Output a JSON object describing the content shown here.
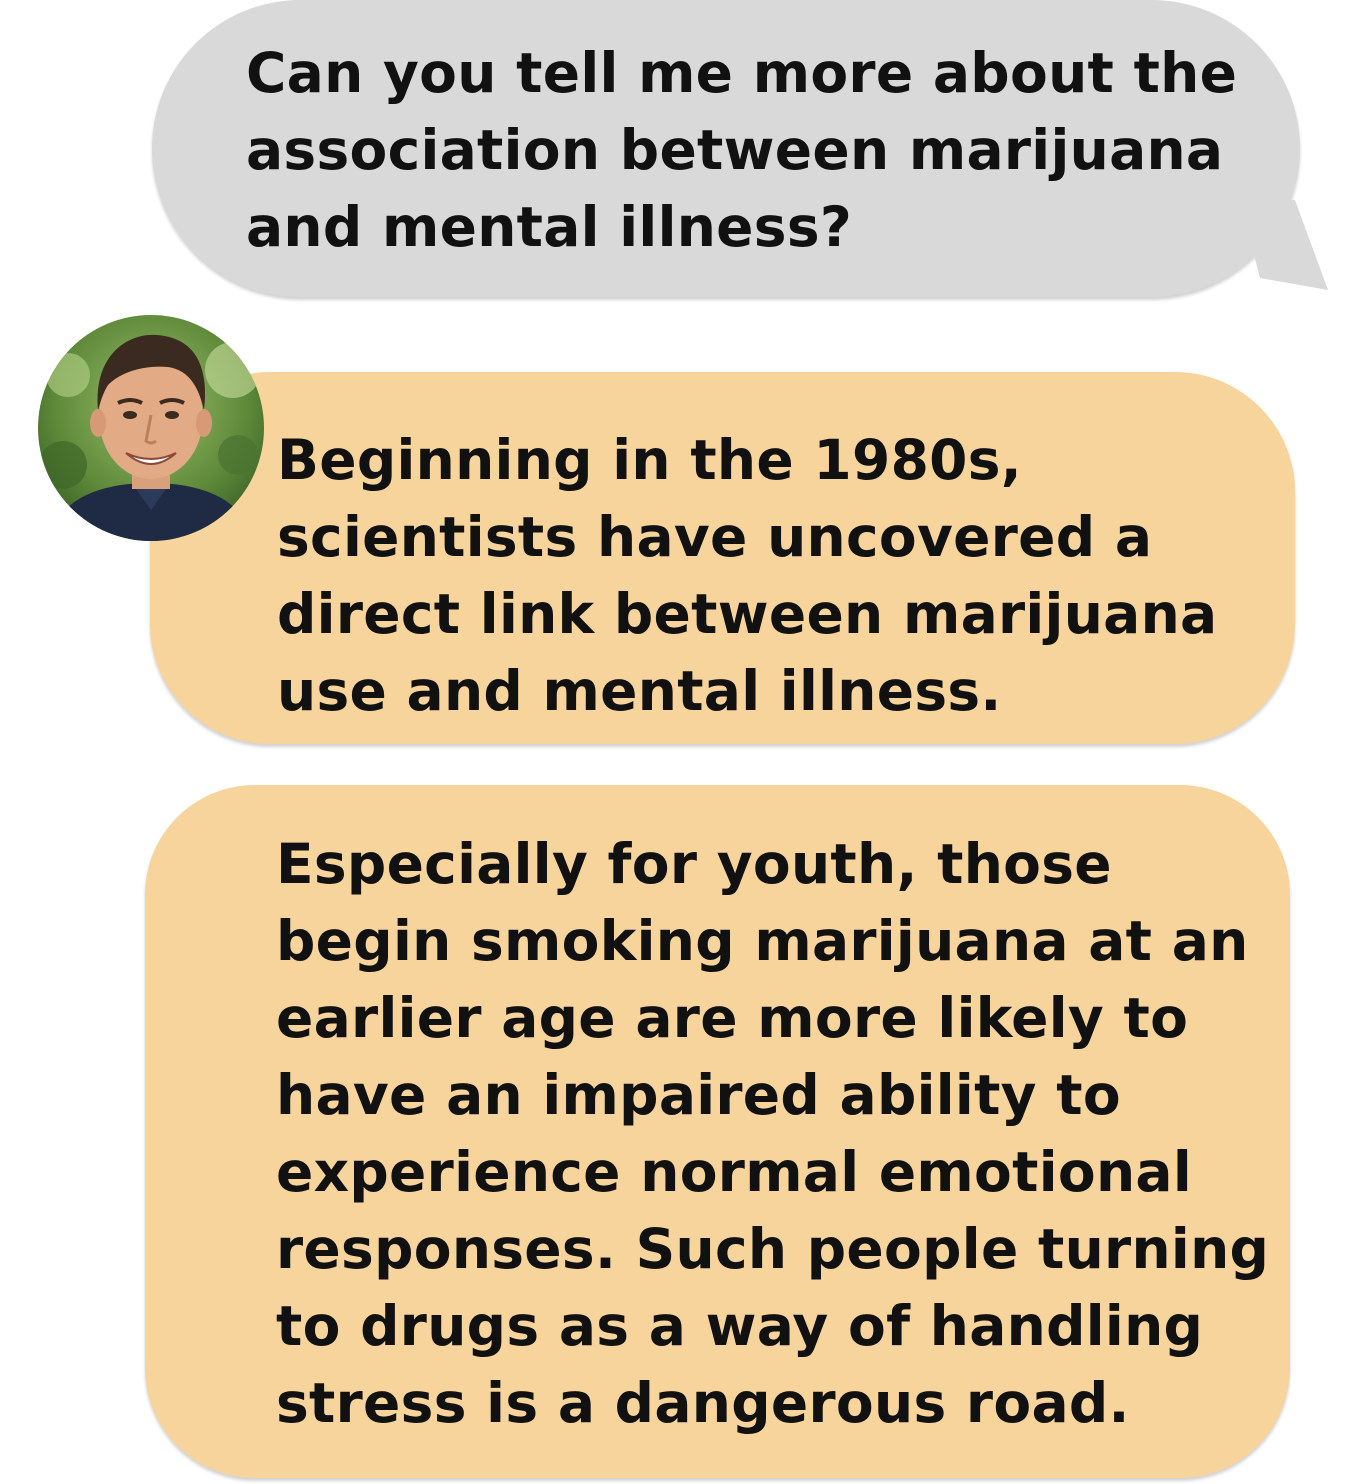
{
  "conversation": {
    "user_message": "Can you tell me more about the association between marijuana and mental illness?",
    "assistant_messages": [
      "Beginning in the 1980s, scientists have uncovered a direct link between marijuana use and mental illness.",
      "Especially for youth, those begin smoking marijuana at an earlier age are more likely to have an impaired ability to experience normal emotional responses. Such people turning to drugs as a way of handling stress is a dangerous road."
    ]
  },
  "colors": {
    "user_bubble": "#d9d9d9",
    "assistant_bubble": "#f7d49c",
    "text": "#111111"
  },
  "icons": {
    "avatar": "assistant-avatar-photo"
  }
}
